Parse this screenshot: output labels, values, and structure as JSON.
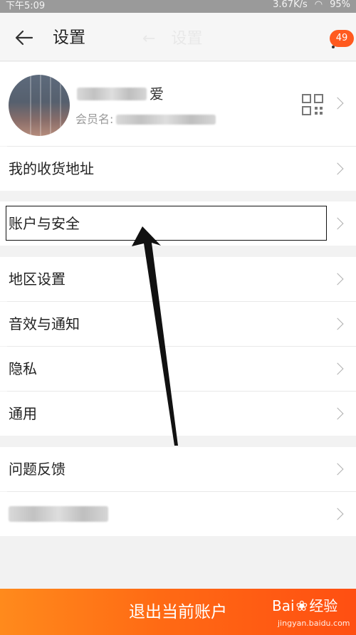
{
  "status_bar": {
    "time": "下午5:09",
    "speed": "3.67K/s",
    "battery": "95%"
  },
  "header": {
    "back_icon": "arrow-left-icon",
    "title": "设置",
    "ghost_text": "设置",
    "more_icon": "more-vertical-icon",
    "badge": "49"
  },
  "profile": {
    "nickname_suffix": "爱",
    "member_label": "会员名:",
    "qr_icon": "qr-code-icon"
  },
  "menu": {
    "address": "我的收货地址",
    "account_security": "账户与安全",
    "region": "地区设置",
    "sound": "音效与通知",
    "privacy": "隐私",
    "general": "通用",
    "feedback": "问题反馈"
  },
  "footer": {
    "logout": "退出当前账户",
    "watermark_logo": "Bai",
    "watermark_text": "经验",
    "watermark_sub": "jingyan.baidu.com"
  },
  "colors": {
    "accent": "#ff6a14",
    "badge": "#ff5a1f",
    "background": "#f2f2f2"
  }
}
